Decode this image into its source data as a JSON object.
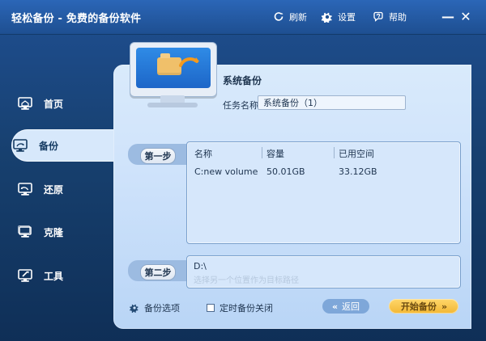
{
  "app": {
    "title": "轻松备份 - 免费的备份软件",
    "refresh_label": "刷新",
    "settings_label": "设置",
    "help_label": "帮助"
  },
  "sidebar": {
    "items": [
      {
        "label": "首页",
        "icon": "monitor-home-icon"
      },
      {
        "label": "备份",
        "icon": "monitor-backup-icon"
      },
      {
        "label": "还原",
        "icon": "monitor-restore-icon"
      },
      {
        "label": "克隆",
        "icon": "monitor-clone-icon"
      },
      {
        "label": "工具",
        "icon": "monitor-tools-icon"
      }
    ],
    "active_index": 1
  },
  "main": {
    "section_title": "系统备份",
    "task_label": "任务名称",
    "task_name": "系统备份（1）",
    "step1_label": "第一步",
    "step2_label": "第二步",
    "table": {
      "headers": [
        "名称",
        "容量",
        "已用空间"
      ],
      "rows": [
        [
          "C:new volume",
          "50.01GB",
          "33.12GB"
        ]
      ]
    },
    "destination": {
      "path": "D:\\",
      "hint": "选择另一个位置作为目标路径"
    },
    "options_label": "备份选项",
    "shutdown_label": "定时备份关闭",
    "back_label": "返回",
    "start_label": "开始备份"
  },
  "colors": {
    "titlebar": "#1e4f91",
    "panel": "#cfe3fb",
    "start_button": "#f2b734"
  }
}
